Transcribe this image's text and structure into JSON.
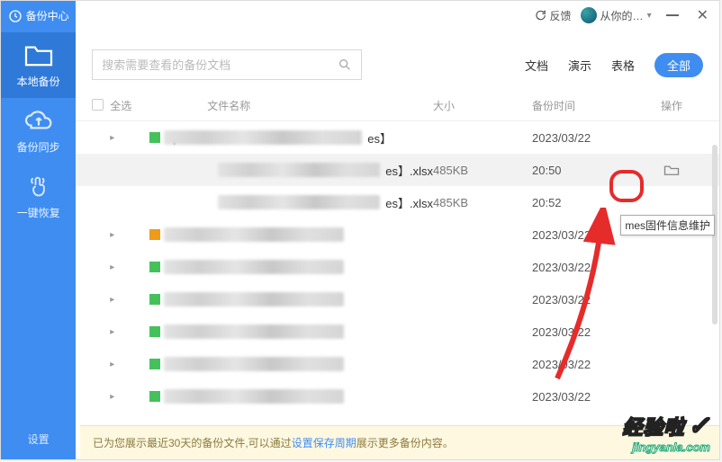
{
  "app_title": "备份中心",
  "titlebar": {
    "feedback": "反馈",
    "username": "从你的…"
  },
  "sidebar": {
    "items": [
      {
        "label": "本地备份"
      },
      {
        "label": "备份同步"
      },
      {
        "label": "一键恢复"
      }
    ],
    "settings": "设置"
  },
  "search": {
    "placeholder": "搜索需要查看的备份文档"
  },
  "filters": {
    "doc": "文档",
    "ppt": "演示",
    "sheet": "表格",
    "all": "全部"
  },
  "columns": {
    "select_all": "全选",
    "name": "文件名称",
    "size": "大小",
    "time": "备份时间",
    "op": "操作"
  },
  "rows": [
    {
      "suffix": "es】",
      "size": "",
      "time": "2023/03/22",
      "hover": false,
      "group": true
    },
    {
      "suffix": "es】.xlsx",
      "size": "485KB",
      "time": "20:50",
      "hover": true,
      "child": true,
      "open": true
    },
    {
      "suffix": "es】.xlsx",
      "size": "485KB",
      "time": "20:52",
      "hover": false,
      "child": true
    },
    {
      "suffix": "",
      "size": "",
      "time": "2023/03/22",
      "hover": false,
      "group": true,
      "orange": true
    },
    {
      "suffix": "",
      "size": "",
      "time": "2023/03/22",
      "hover": false,
      "group": true
    },
    {
      "suffix": "",
      "size": "",
      "time": "2023/03/22",
      "hover": false,
      "group": true
    },
    {
      "suffix": "",
      "size": "",
      "time": "2023/03/22",
      "hover": false,
      "group": true
    },
    {
      "suffix": "",
      "size": "",
      "time": "2023/03/22",
      "hover": false,
      "group": true
    },
    {
      "suffix": "",
      "size": "",
      "time": "2023/03/22",
      "hover": false,
      "group": true
    }
  ],
  "tooltip": "mes固件信息维护",
  "footer": {
    "pre": "已为您展示最近30天的备份文件,可以通过 ",
    "link": "设置保存周期",
    "post": " 展示更多备份内容。"
  },
  "watermark": {
    "brand": "经验啦",
    "site": "jingyanla.com"
  }
}
